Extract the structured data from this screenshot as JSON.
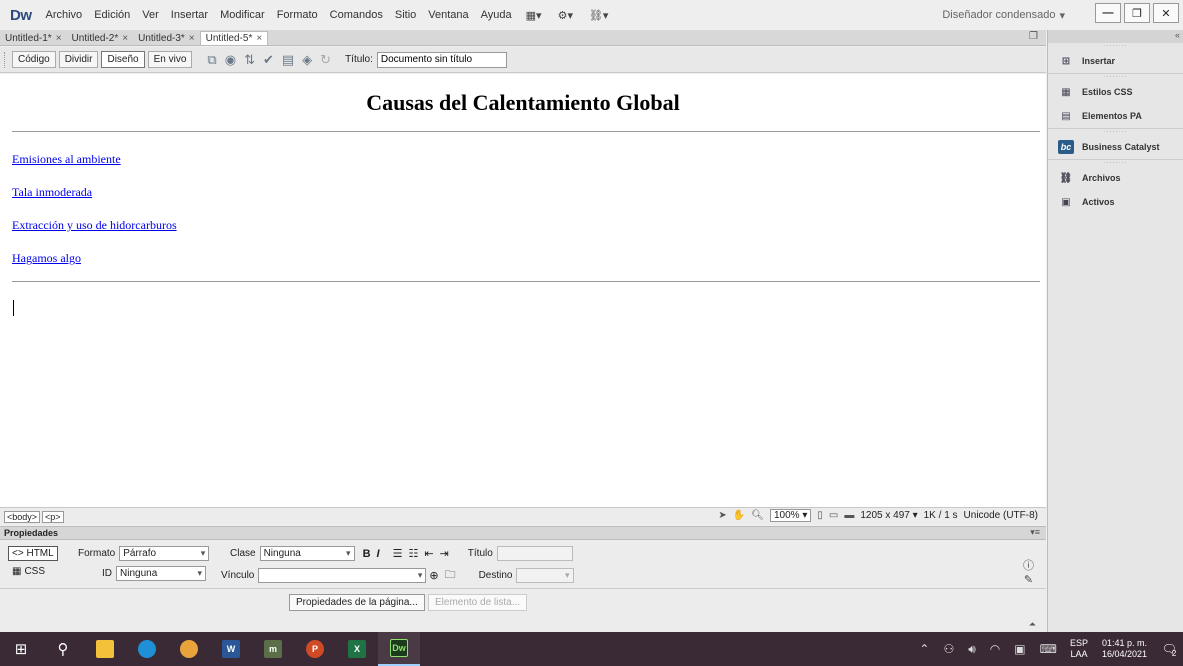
{
  "app": {
    "logo": "Dw",
    "menu": [
      "Archivo",
      "Edición",
      "Ver",
      "Insertar",
      "Modificar",
      "Formato",
      "Comandos",
      "Sitio",
      "Ventana",
      "Ayuda"
    ],
    "workspace": "Diseñador condensado",
    "workspace_arrow": "▾"
  },
  "tabs": [
    {
      "label": "Untitled-1*",
      "close": "×"
    },
    {
      "label": "Untitled-2*",
      "close": "×"
    },
    {
      "label": "Untitled-3*",
      "close": "×"
    },
    {
      "label": "Untitled-5*",
      "close": "×"
    }
  ],
  "toolbar": {
    "views": [
      "Código",
      "Dividir",
      "Diseño",
      "En vivo"
    ],
    "title_label": "Título:",
    "title_value": "Documento sin título"
  },
  "document": {
    "heading": "Causas del Calentamiento Global",
    "links": [
      "Emisiones al ambiente",
      "Tala inmoderada",
      "Extracción y uso de hidorcarburos",
      "Hagamos algo"
    ]
  },
  "statusbar": {
    "tags": [
      "<body>",
      "<p>"
    ],
    "zoom": "100%",
    "dimensions": "1205 x 497 ▾",
    "size_time": "1K / 1 s",
    "encoding": "Unicode (UTF-8)"
  },
  "properties": {
    "title": "Propiedades",
    "html_btn": "HTML",
    "css_btn": "CSS",
    "formato_label": "Formato",
    "formato_value": "Párrafo",
    "clase_label": "Clase",
    "clase_value": "Ninguna",
    "id_label": "ID",
    "id_value": "Ninguna",
    "vinculo_label": "Vínculo",
    "titulo_label": "Título",
    "destino_label": "Destino",
    "bold": "B",
    "italic": "I",
    "page_props_btn": "Propiedades de la página...",
    "list_item_btn": "Elemento de lista..."
  },
  "panels": [
    {
      "label": "Insertar",
      "icon": "insert-icon"
    },
    {
      "label": "Estilos CSS",
      "icon": "css-styles-icon"
    },
    {
      "label": "Elementos PA",
      "icon": "ap-elements-icon"
    },
    {
      "label": "Business Catalyst",
      "icon": "business-catalyst-icon"
    },
    {
      "label": "Archivos",
      "icon": "files-icon"
    },
    {
      "label": "Activos",
      "icon": "assets-icon"
    }
  ],
  "taskbar": {
    "lang_top": "ESP",
    "lang_bottom": "LAA",
    "time": "01:41 p. m.",
    "date": "16/04/2021",
    "notifications": "2"
  }
}
